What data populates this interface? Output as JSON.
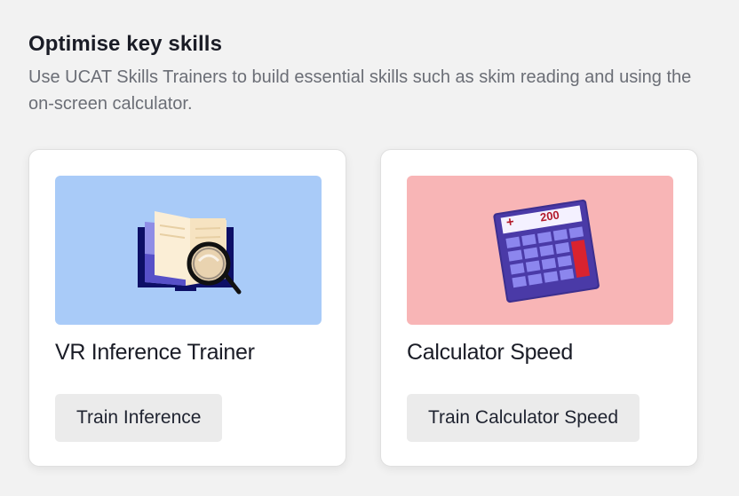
{
  "section": {
    "title": "Optimise key skills",
    "description": "Use UCAT Skills Trainers to build essential skills such as skim reading and using the on-screen calculator."
  },
  "cards": [
    {
      "title": "VR Inference Trainer",
      "button_label": "Train Inference",
      "illustration": "book-magnifier-icon",
      "image_bg": "#a9cbf8"
    },
    {
      "title": "Calculator Speed",
      "button_label": "Train Calculator Speed",
      "illustration": "calculator-icon",
      "image_bg": "#f8b5b6",
      "calculator_display": {
        "operator": "+",
        "value": "200"
      }
    }
  ],
  "colors": {
    "page_bg": "#f2f2f2",
    "card_bg": "#ffffff",
    "button_bg": "#ebebeb",
    "title_text": "#1a1c26",
    "desc_text": "#6b6e76"
  }
}
